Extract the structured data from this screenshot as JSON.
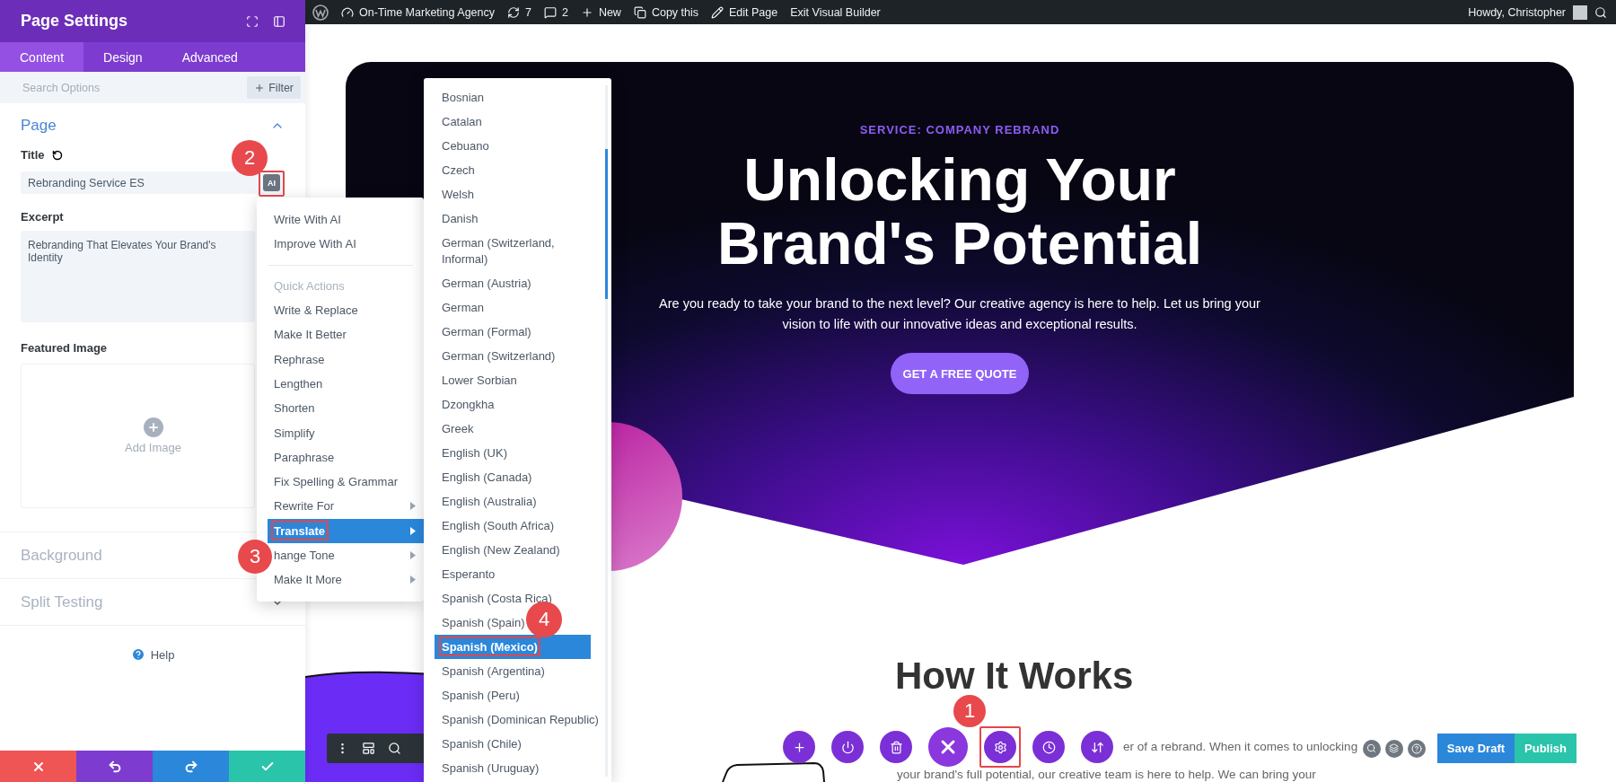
{
  "panel": {
    "title": "Page Settings",
    "tabs": [
      {
        "label": "Content",
        "selected": true
      },
      {
        "label": "Design",
        "selected": false
      },
      {
        "label": "Advanced",
        "selected": false
      }
    ],
    "search": {
      "placeholder": "Search Options"
    },
    "filter_label": "Filter",
    "section": {
      "title": "Page",
      "expanded": true
    },
    "title_field": {
      "label": "Title",
      "value": "Rebranding Service ES",
      "ai_label": "AI"
    },
    "excerpt_field": {
      "label": "Excerpt",
      "value": "Rebranding That Elevates Your Brand's Identity"
    },
    "image_field": {
      "label": "Featured Image",
      "button": "Add Image"
    },
    "collapsed_sections": [
      {
        "title": "Background"
      },
      {
        "title": "Split Testing",
        "expanded": false
      }
    ],
    "help": "Help"
  },
  "admin_bar": {
    "items": [
      {
        "kind": "logo"
      },
      {
        "kind": "site",
        "label": "On-Time Marketing Agency"
      },
      {
        "kind": "updates",
        "label": "7"
      },
      {
        "kind": "comments",
        "label": "2"
      },
      {
        "kind": "new",
        "label": "New"
      },
      {
        "kind": "copy",
        "label": "Copy this"
      },
      {
        "kind": "edit",
        "label": "Edit Page"
      },
      {
        "kind": "exit",
        "label": "Exit Visual Builder"
      }
    ],
    "greeting": "Howdy, Christopher"
  },
  "hero": {
    "eyebrow": "SERVICE: COMPANY REBRAND",
    "title_lines": [
      "Unlocking Your",
      "Brand's Potential"
    ],
    "text_lines": [
      "Are you ready to take your brand to the next level? Our creative agency is here to help. Let us bring your",
      "vision to life with our innovative ideas and exceptional results."
    ],
    "button": "GET A FREE QUOTE"
  },
  "how_it_works": {
    "heading": "How It Works",
    "lines": [
      "er of a rebrand. When it comes to unlocking",
      "your brand's full potential, our creative team is here to help. We can bring your"
    ]
  },
  "ai_menu": {
    "items": [
      {
        "kind": "action",
        "label": "Write With AI",
        "selected": false
      },
      {
        "kind": "action",
        "label": "Improve With AI",
        "selected": false
      },
      {
        "kind": "heading",
        "label": "Quick Actions"
      },
      {
        "kind": "action",
        "label": "Write & Replace",
        "selected": false
      },
      {
        "kind": "action",
        "label": "Make It Better",
        "selected": false
      },
      {
        "kind": "action",
        "label": "Rephrase",
        "selected": false
      },
      {
        "kind": "action",
        "label": "Lengthen",
        "selected": false
      },
      {
        "kind": "action",
        "label": "Shorten",
        "selected": false
      },
      {
        "kind": "action",
        "label": "Simplify",
        "selected": false
      },
      {
        "kind": "action",
        "label": "Paraphrase",
        "selected": false
      },
      {
        "kind": "action",
        "label": "Fix Spelling & Grammar",
        "selected": false
      },
      {
        "kind": "submenu",
        "label": "Rewrite For",
        "selected": false
      },
      {
        "kind": "submenu",
        "label": "Translate",
        "selected": true
      },
      {
        "kind": "submenu",
        "label": "hange Tone",
        "selected": false
      },
      {
        "kind": "submenu",
        "label": "Make It More",
        "selected": false
      }
    ]
  },
  "language_menu": {
    "items": [
      {
        "label": "Bosnian",
        "selected": false
      },
      {
        "label": "Catalan",
        "selected": false
      },
      {
        "label": "Cebuano",
        "selected": false
      },
      {
        "label": "Czech",
        "selected": false
      },
      {
        "label": "Welsh",
        "selected": false
      },
      {
        "label": "Danish",
        "selected": false
      },
      {
        "label": "German (Switzerland, Informal)",
        "selected": false
      },
      {
        "label": "German (Austria)",
        "selected": false
      },
      {
        "label": "German",
        "selected": false
      },
      {
        "label": "German (Formal)",
        "selected": false
      },
      {
        "label": "German (Switzerland)",
        "selected": false
      },
      {
        "label": "Lower Sorbian",
        "selected": false
      },
      {
        "label": "Dzongkha",
        "selected": false
      },
      {
        "label": "Greek",
        "selected": false
      },
      {
        "label": "English (UK)",
        "selected": false
      },
      {
        "label": "English (Canada)",
        "selected": false
      },
      {
        "label": "English (Australia)",
        "selected": false
      },
      {
        "label": "English (South Africa)",
        "selected": false
      },
      {
        "label": "English (New Zealand)",
        "selected": false
      },
      {
        "label": "Esperanto",
        "selected": false
      },
      {
        "label": "Spanish (Costa Rica)",
        "selected": false
      },
      {
        "label": "Spanish (Spain)",
        "selected": false
      },
      {
        "label": "Spanish (Mexico)",
        "selected": true
      },
      {
        "label": "Spanish (Argentina)",
        "selected": false
      },
      {
        "label": "Spanish (Peru)",
        "selected": false
      },
      {
        "label": "Spanish (Dominican Republic)",
        "selected": false
      },
      {
        "label": "Spanish (Chile)",
        "selected": false
      },
      {
        "label": "Spanish (Uruguay)",
        "selected": false
      }
    ]
  },
  "builder_toolbar": {
    "buttons": [
      {
        "kind": "add"
      },
      {
        "kind": "power"
      },
      {
        "kind": "trash"
      },
      {
        "kind": "close"
      },
      {
        "kind": "settings"
      },
      {
        "kind": "history"
      },
      {
        "kind": "sort"
      }
    ]
  },
  "page_actions": {
    "save_draft": "Save Draft",
    "publish": "Publish"
  },
  "callouts": [
    {
      "number": "2"
    },
    {
      "number": "3"
    },
    {
      "number": "4"
    },
    {
      "number": "1"
    }
  ]
}
